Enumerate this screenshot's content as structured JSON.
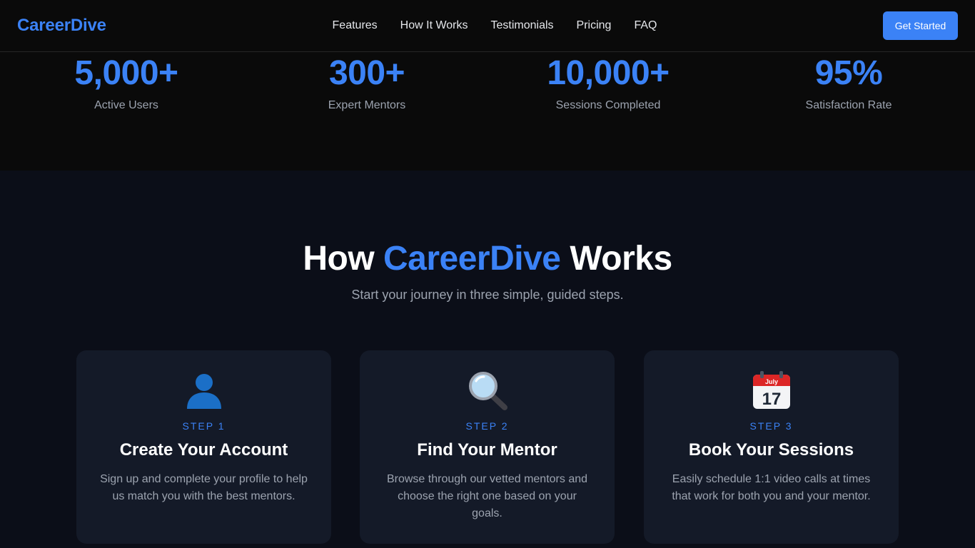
{
  "nav": {
    "logo": "CareerDive",
    "links": [
      "Features",
      "How It Works",
      "Testimonials",
      "Pricing",
      "FAQ"
    ],
    "cta_label": "Get Started"
  },
  "stats": [
    {
      "value": "5,000+",
      "label": "Active Users"
    },
    {
      "value": "300+",
      "label": "Expert Mentors"
    },
    {
      "value": "10,000+",
      "label": "Sessions Completed"
    },
    {
      "value": "95%",
      "label": "Satisfaction Rate"
    }
  ],
  "how_it_works": {
    "title_prefix": "How ",
    "title_accent": "CareerDive",
    "title_suffix": " Works",
    "subtitle": "Start your journey in three simple, guided steps.",
    "steps": [
      {
        "icon": "user-silhouette-icon",
        "step": "STEP 1",
        "title": "Create Your Account",
        "description": "Sign up and complete your profile to help us match you with the best mentors."
      },
      {
        "icon": "magnifier-icon",
        "step": "STEP 2",
        "title": "Find Your Mentor",
        "description": "Browse through our vetted mentors and choose the right one based on your goals."
      },
      {
        "icon": "calendar-icon",
        "step": "STEP 3",
        "title": "Book Your Sessions",
        "description": "Easily schedule 1:1 video calls at times that work for both you and your mentor."
      }
    ],
    "calendar_month": "July",
    "calendar_day": "17"
  },
  "colors": {
    "accent": "#3b82f6",
    "background": "#0a0a0a",
    "section_background": "#0b0e18",
    "card_background": "#141a28"
  }
}
